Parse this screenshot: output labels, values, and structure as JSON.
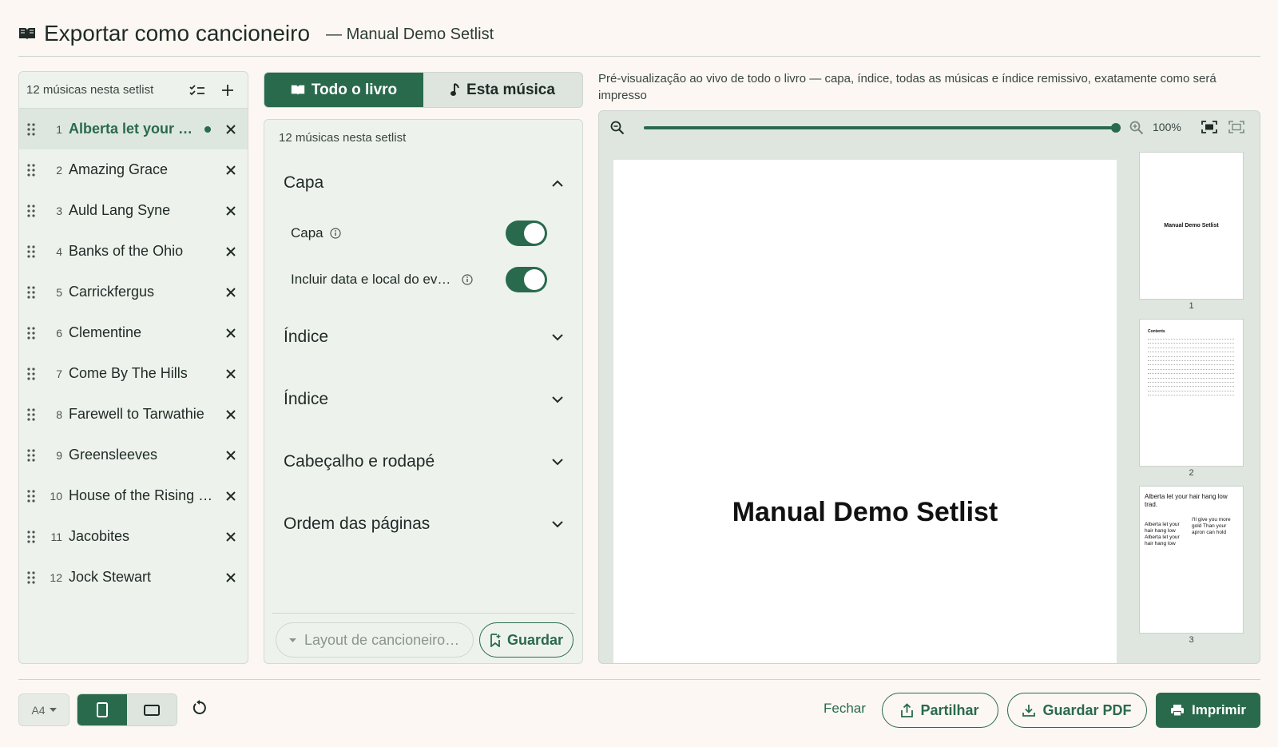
{
  "header": {
    "title": "Exportar como cancioneiro",
    "subtitle": "— Manual Demo Setlist"
  },
  "songlist": {
    "count_label": "12 músicas nesta setlist",
    "songs": [
      {
        "num": "1",
        "name": "Alberta let your hair hang low",
        "active": true,
        "modified": true
      },
      {
        "num": "2",
        "name": "Amazing Grace"
      },
      {
        "num": "3",
        "name": "Auld Lang Syne"
      },
      {
        "num": "4",
        "name": "Banks of the Ohio"
      },
      {
        "num": "5",
        "name": "Carrickfergus"
      },
      {
        "num": "6",
        "name": "Clementine"
      },
      {
        "num": "7",
        "name": "Come By The Hills"
      },
      {
        "num": "8",
        "name": "Farewell to Tarwathie"
      },
      {
        "num": "9",
        "name": "Greensleeves"
      },
      {
        "num": "10",
        "name": "House of the Rising Sun"
      },
      {
        "num": "11",
        "name": "Jacobites"
      },
      {
        "num": "12",
        "name": "Jock Stewart"
      }
    ]
  },
  "tabs": [
    {
      "label": "Todo o livro",
      "icon": "book-icon",
      "selected": true
    },
    {
      "label": "Esta música",
      "icon": "music-note-icon",
      "selected": false
    }
  ],
  "settings": {
    "count_label": "12 músicas nesta setlist",
    "sections": {
      "capa": "Capa",
      "indice1": "Índice",
      "indice2": "Índice",
      "cabecalho": "Cabeçalho e rodapé",
      "ordem": "Ordem das páginas"
    },
    "options": {
      "capa_label": "Capa",
      "capa_on": true,
      "data_local_label": "Incluir data e local do evento",
      "data_local_on": true
    },
    "layout_placeholder": "Layout de cancioneiro…",
    "save_label": "Guardar"
  },
  "preview": {
    "description": "Pré-visualização ao vivo de todo o livro — capa, índice, todas as músicas e índice remissivo, exatamente como será impresso",
    "zoom": "100%",
    "zoom_fraction": 1.0,
    "cover_title": "Manual Demo Setlist",
    "thumbnails": [
      {
        "page": "1",
        "title": "Manual Demo Setlist"
      },
      {
        "page": "2",
        "heading": "Contents"
      },
      {
        "page": "3",
        "song_title": "Alberta let your hair hang low trad.",
        "col1": "Alberta let your hair hang low Alberta let your hair hang low",
        "col2": "I'll give you more gold Than your apron can hold"
      }
    ]
  },
  "footer": {
    "paper_size": "A4",
    "orientation": "portrait",
    "close_label": "Fechar",
    "share_label": "Partilhar",
    "save_pdf_label": "Guardar PDF",
    "print_label": "Imprimir"
  },
  "colors": {
    "accent": "#2a6a4c",
    "background": "#fcf7f2",
    "panel": "#eef2ed"
  }
}
